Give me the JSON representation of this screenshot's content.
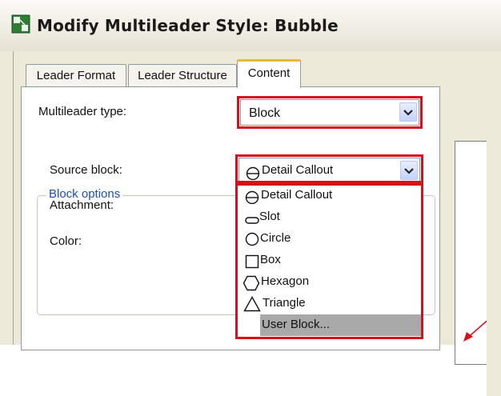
{
  "window": {
    "title": "Modify Multileader Style: Bubble"
  },
  "tabs": [
    {
      "label": "Leader Format"
    },
    {
      "label": "Leader Structure"
    },
    {
      "label": "Content"
    }
  ],
  "content": {
    "multileader_type_label": "Multileader type:",
    "multileader_type_value": "Block",
    "block_options": {
      "group_title": "Block options",
      "source_block_label": "Source block:",
      "source_block_value": "Detail Callout",
      "attachment_label": "Attachment:",
      "color_label": "Color:"
    }
  },
  "source_block_dropdown": {
    "options": [
      {
        "label": "Detail Callout",
        "icon": "detail-callout-icon"
      },
      {
        "label": "Slot",
        "icon": "slot-icon"
      },
      {
        "label": "Circle",
        "icon": "circle-icon"
      },
      {
        "label": "Box",
        "icon": "box-icon"
      },
      {
        "label": "Hexagon",
        "icon": "hexagon-icon"
      },
      {
        "label": "Triangle",
        "icon": "triangle-icon"
      },
      {
        "label": "User Block...",
        "icon": "",
        "selected": true
      }
    ]
  },
  "colors": {
    "highlight": "#d3121c",
    "active_tab_accent": "#f0b33c",
    "group_title": "#1f4fb5",
    "preview_arrow": "#d3121c"
  }
}
